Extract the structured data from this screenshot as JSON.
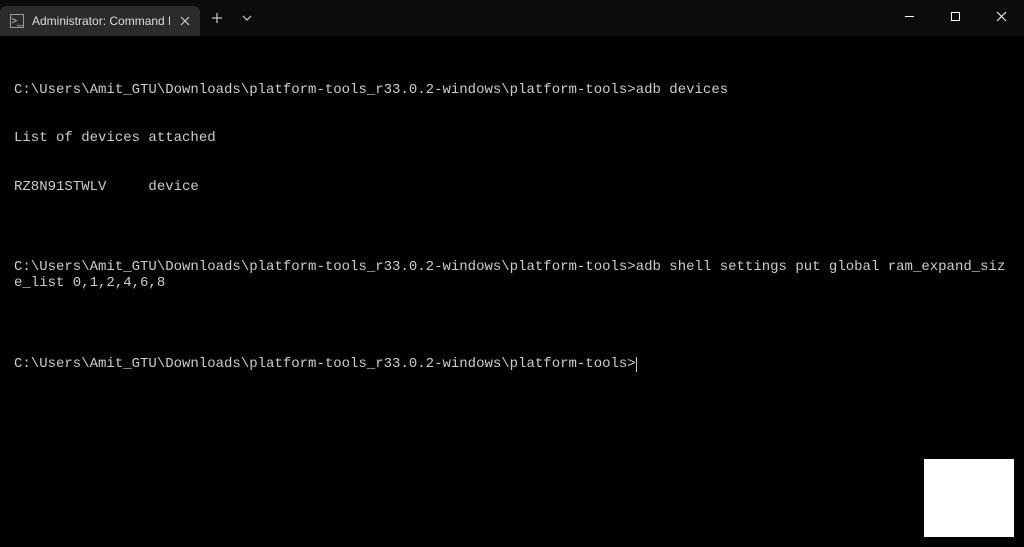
{
  "tab": {
    "title": "Administrator: Command Pro",
    "icon_label": ">_"
  },
  "terminal": {
    "line1_prompt": "C:\\Users\\Amit_GTU\\Downloads\\platform-tools_r33.0.2-windows\\platform-tools>",
    "line1_cmd": "adb devices",
    "line2": "List of devices attached",
    "line3": "RZ8N91STWLV     device",
    "blank1": "",
    "line4_prompt": "C:\\Users\\Amit_GTU\\Downloads\\platform-tools_r33.0.2-windows\\platform-tools>",
    "line4_cmd": "adb shell settings put global ram_expand_size_list 0,1,2,4,6,8",
    "blank2": "",
    "line5_prompt": "C:\\Users\\Amit_GTU\\Downloads\\platform-tools_r33.0.2-windows\\platform-tools>"
  }
}
